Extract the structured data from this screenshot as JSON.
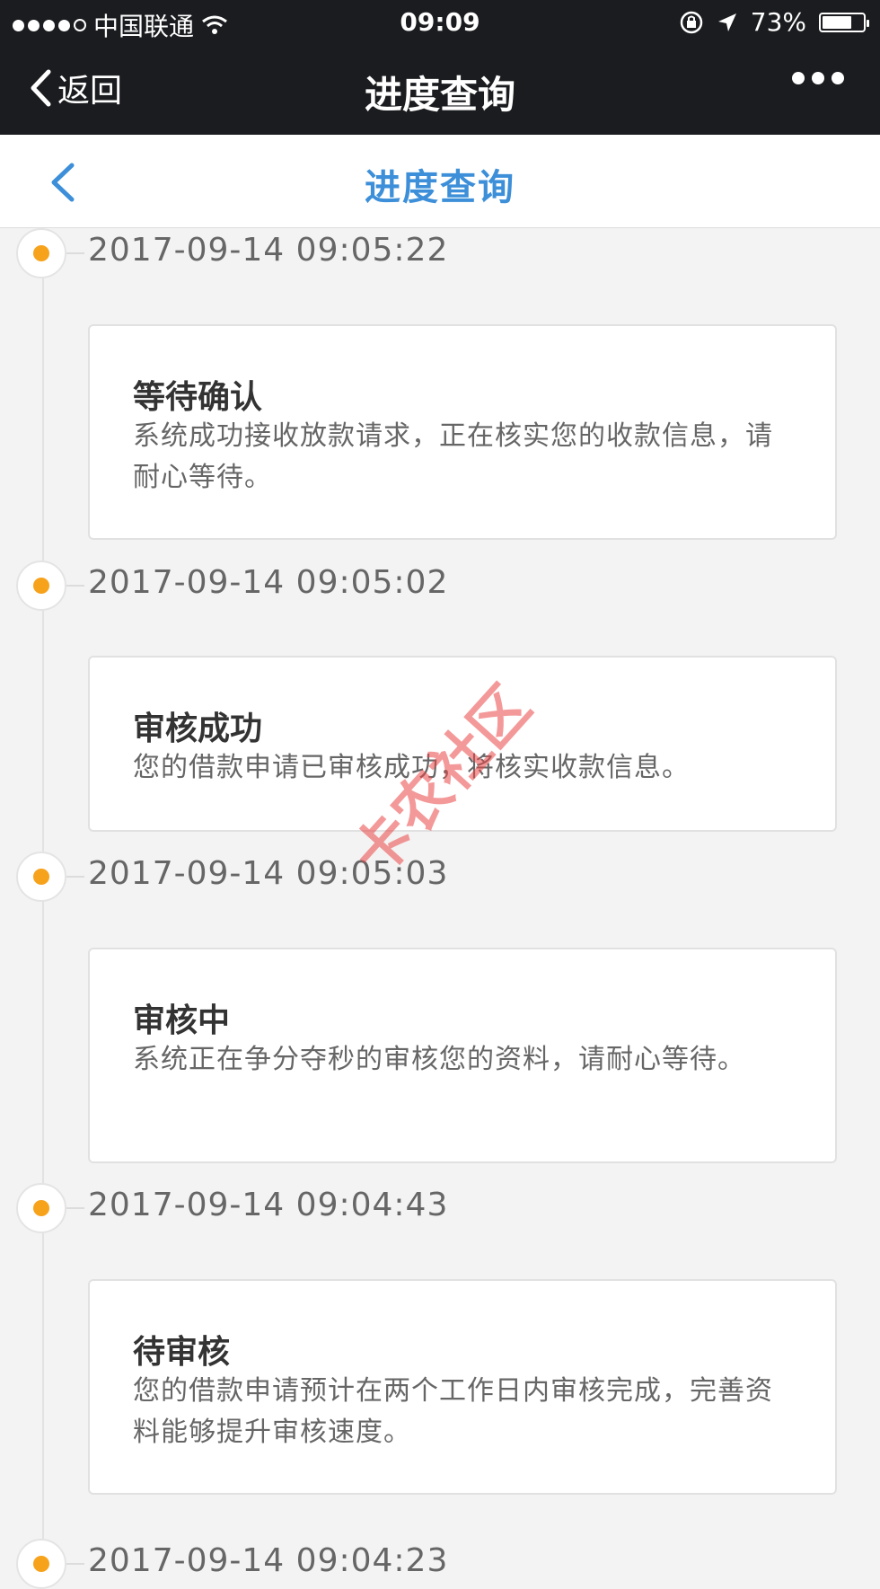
{
  "status_bar": {
    "carrier": "中国联通",
    "time": "09:09",
    "battery": "73%",
    "battery_level": 0.73
  },
  "nav": {
    "back_label": "返回",
    "title": "进度查询"
  },
  "page": {
    "title": "进度查询"
  },
  "timeline": [
    {
      "time": "2017-09-14 09:05:22",
      "title": "等待确认",
      "desc": "系统成功接收放款请求，正在核实您的收款信息，请耐心等待。"
    },
    {
      "time": "2017-09-14 09:05:02",
      "title": "审核成功",
      "desc": "您的借款申请已审核成功，将核实收款信息。"
    },
    {
      "time": "2017-09-14 09:05:03",
      "title": "审核中",
      "desc": "系统正在争分夺秒的审核您的资料，请耐心等待。"
    },
    {
      "time": "2017-09-14 09:04:43",
      "title": "待审核",
      "desc": "您的借款申请预计在两个工作日内审核完成，完善资料能够提升审核速度。"
    },
    {
      "time": "2017-09-14 09:04:23"
    }
  ],
  "watermark": "卡农社区"
}
